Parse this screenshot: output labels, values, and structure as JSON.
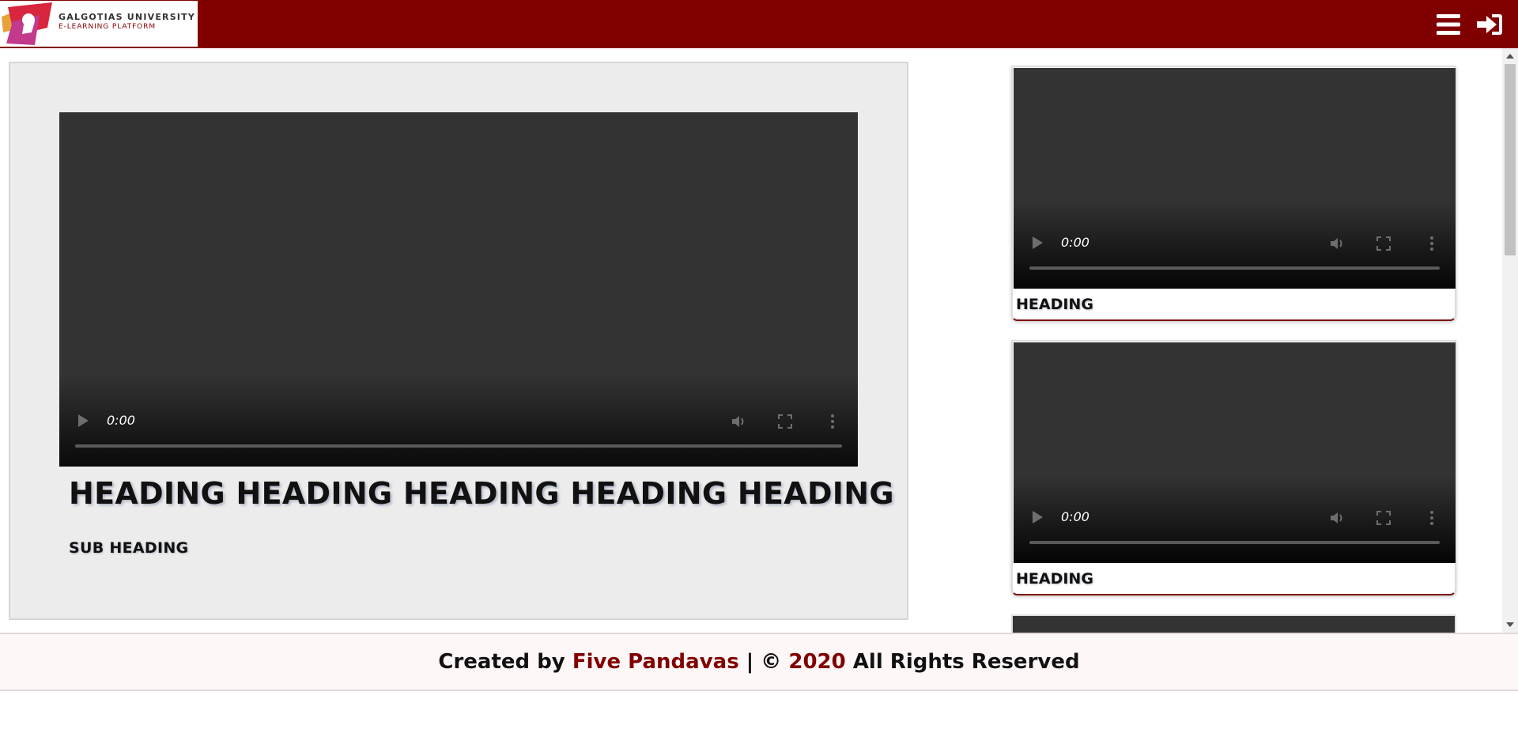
{
  "header": {
    "logo_title": "GALGOTIAS UNIVERSITY",
    "logo_subtitle": "E-LEARNING PLATFORM",
    "menu_icon": "hamburger-menu-icon",
    "login_icon": "sign-in-icon",
    "background_color": "#800000"
  },
  "main": {
    "video_time": "0:00",
    "heading": "HEADING HEADING HEADING HEADING HEADING",
    "subheading": "SUB HEADING"
  },
  "sidebar": {
    "cards": [
      {
        "time": "0:00",
        "heading": "HEADING"
      },
      {
        "time": "0:00",
        "heading": "HEADING"
      }
    ]
  },
  "footer": {
    "prefix": "Created by",
    "author": "Five Pandavas",
    "separator": "|",
    "copyright_symbol": "©",
    "year": "2020",
    "suffix": "All Rights Reserved",
    "accent_color": "#800000"
  }
}
